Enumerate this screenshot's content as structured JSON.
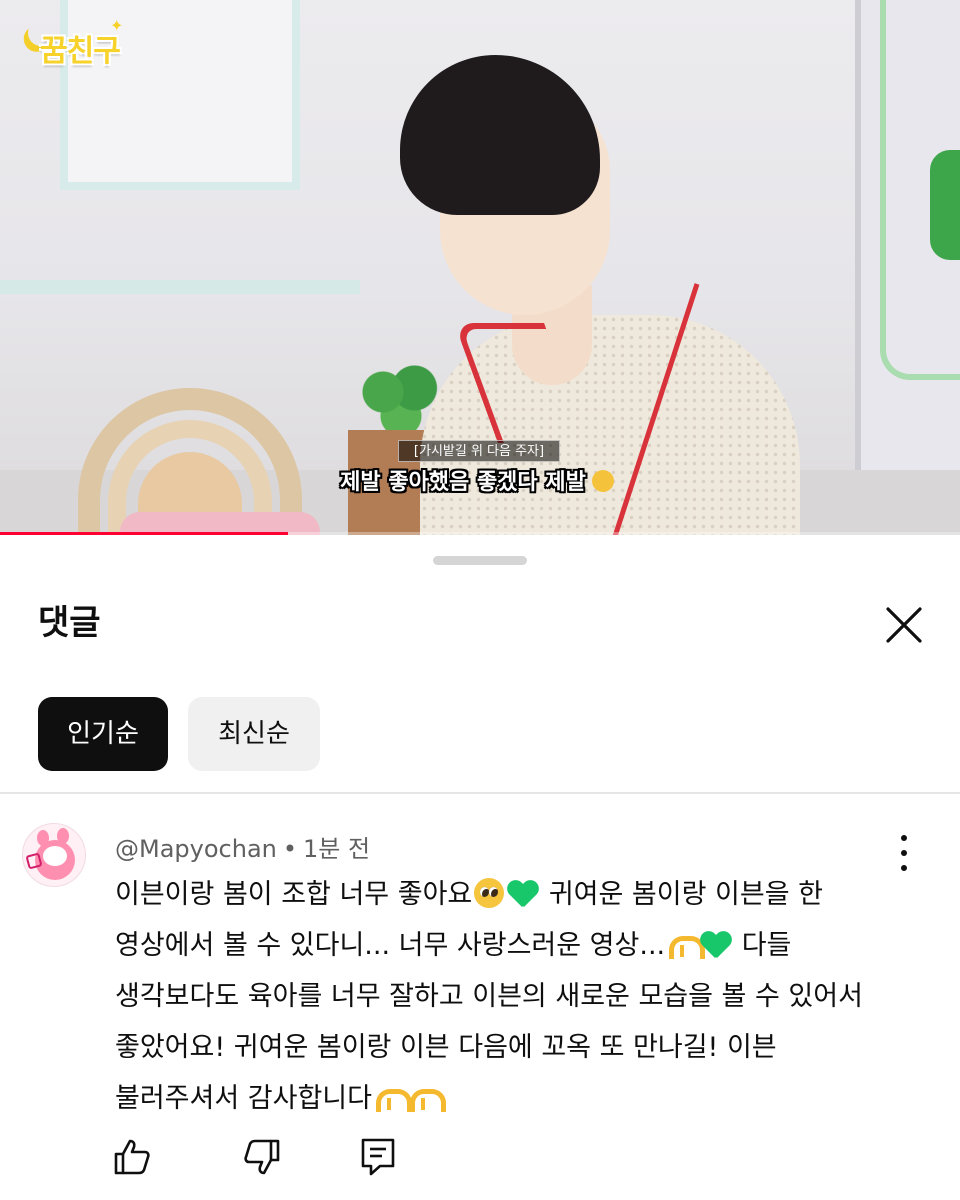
{
  "video": {
    "logo_text": "꿈친구",
    "caption_box": "[가시밭길 위 다음 주자]",
    "caption_main": "제발 좋아했음 좋겠다 제발",
    "progress": 0.3
  },
  "comments_panel": {
    "title": "댓글",
    "close_icon": "close-icon",
    "sort_chips": [
      {
        "label": "인기순",
        "selected": true
      },
      {
        "label": "최신순",
        "selected": false
      }
    ]
  },
  "comment": {
    "author": "@Mapyochan",
    "time": "1분 전",
    "lines": [
      "이븐이랑 봄이 조합 너무 좋아요",
      " 귀여운 봄이랑 이븐을 한",
      "영상에서 볼 수 있다니... 너무 사랑스러운 영상...",
      " 다들",
      "생각보다도 육아를 너무 잘하고 이븐의 새로운 모습을 볼 수 있어서",
      "좋았어요! 귀여운 봄이랑 이븐 다음에 꼬옥 또 만나길! 이븐",
      "불러주셔서 감사합니다"
    ],
    "actions": {
      "like_icon": "thumbs-up-icon",
      "dislike_icon": "thumbs-down-icon",
      "reply_icon": "reply-icon"
    }
  },
  "colors": {
    "progress": "#ff0033",
    "chip_selected_bg": "#0f0f0f",
    "chip_bg": "#f0f0f0",
    "meta_text": "#606060"
  }
}
